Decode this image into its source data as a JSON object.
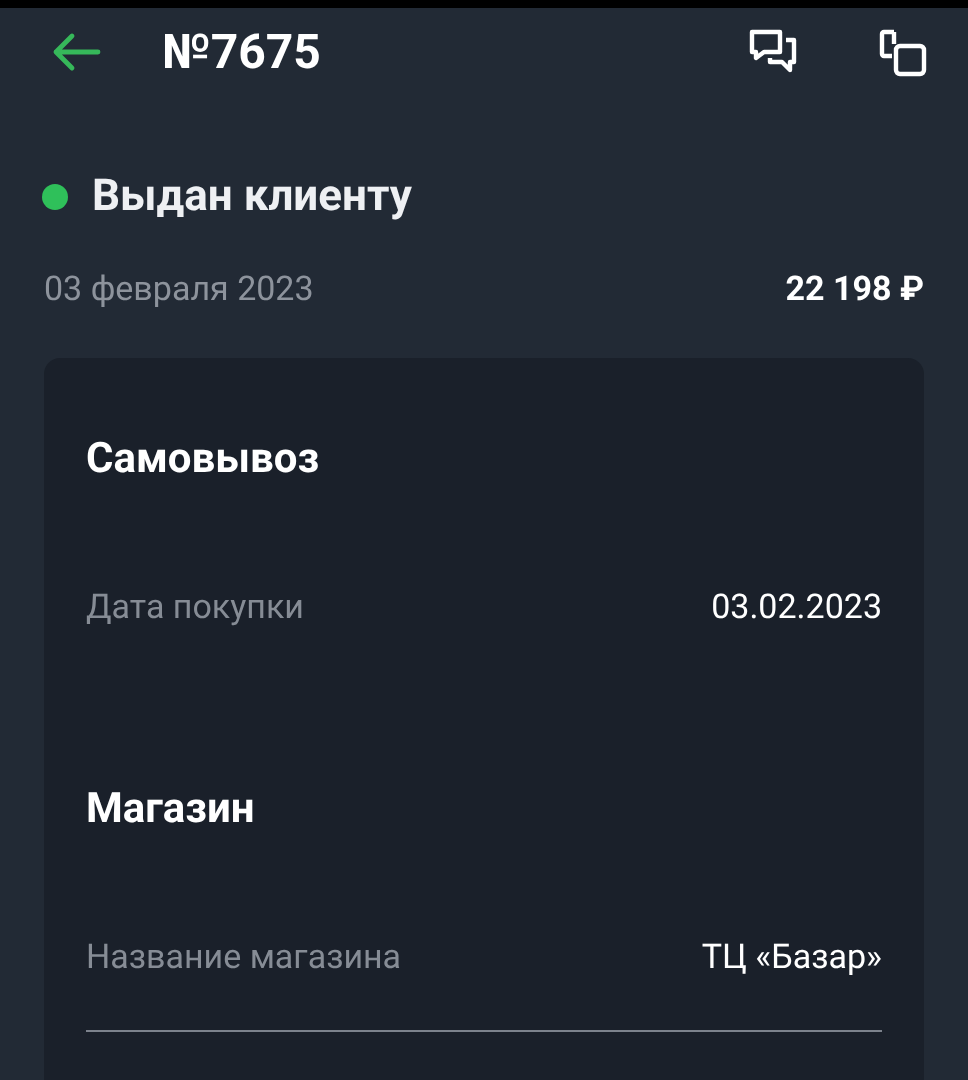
{
  "header": {
    "title": "№7675"
  },
  "status": {
    "label": "Выдан клиенту",
    "color": "#2fc05a"
  },
  "summary": {
    "date": "03 февраля 2023",
    "total": "22 198 ₽"
  },
  "sections": [
    {
      "title": "Самовывоз",
      "rows": [
        {
          "label": "Дата покупки",
          "value": "03.02.2023"
        }
      ]
    },
    {
      "title": "Магазин",
      "rows": [
        {
          "label": "Название магазина",
          "value": "ТЦ «Базар»"
        }
      ]
    }
  ]
}
